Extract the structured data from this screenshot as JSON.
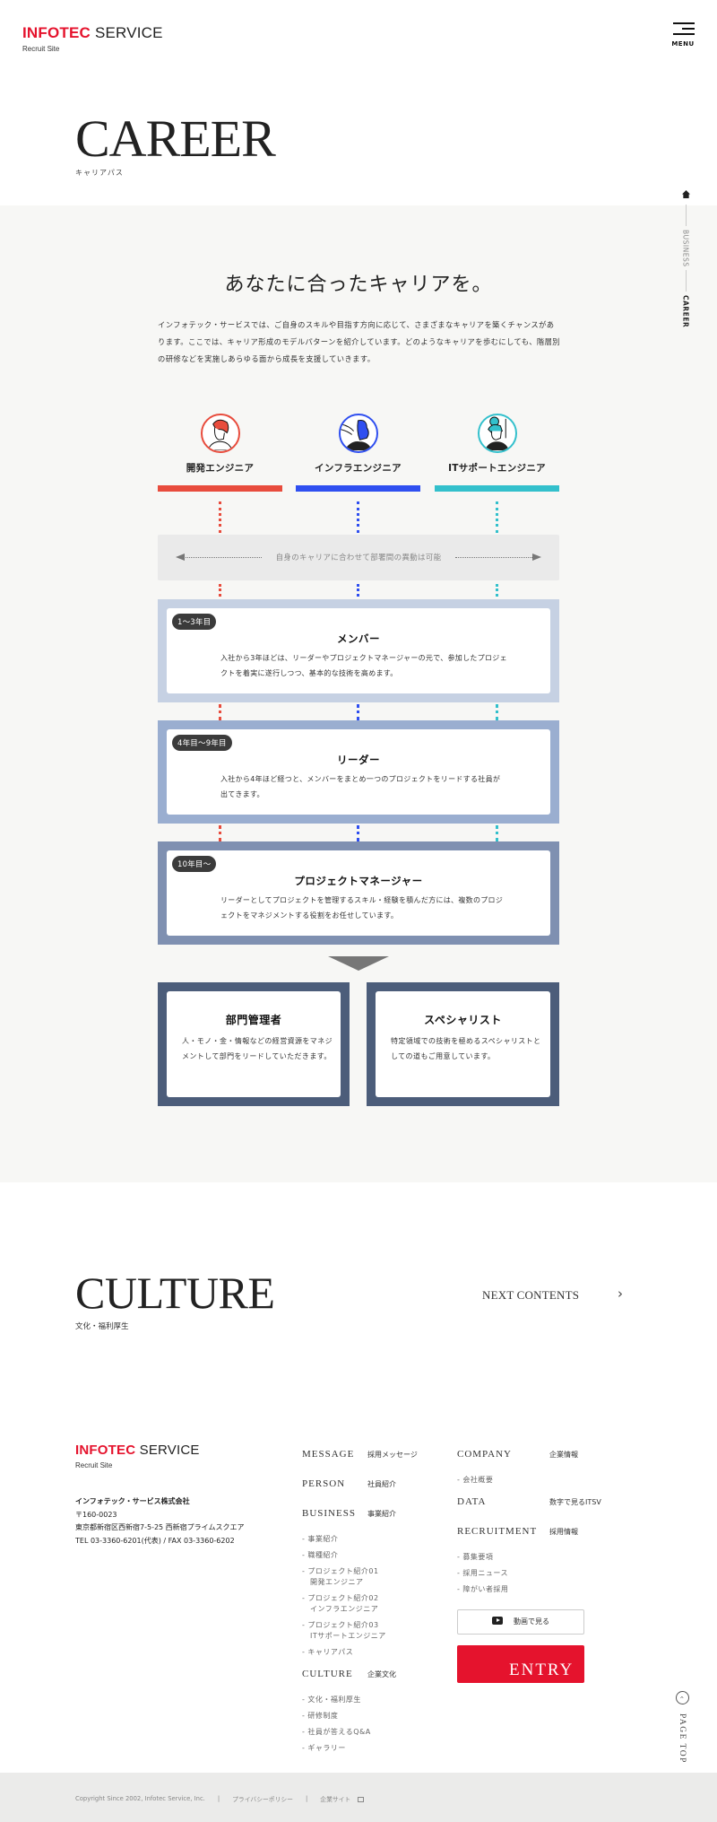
{
  "header": {
    "logo_brand": "INFOTEC",
    "logo_service": "SERVICE",
    "logo_sub": "Recruit Site",
    "menu_label": "MENU"
  },
  "page": {
    "title": "CAREER",
    "subtitle": "キャリアパス"
  },
  "side_nav": {
    "home_icon": "home-icon",
    "items": [
      {
        "label": "BUSINESS",
        "active": false
      },
      {
        "label": "CAREER",
        "active": true
      }
    ]
  },
  "career": {
    "catch": "あなたに合ったキャリアを。",
    "lead": "インフォテック・サービスでは、ご自身のスキルや目指す方向に応じて、さまざまなキャリアを築くチャンスがあります。ここでは、キャリア形成のモデルパターンを紹介しています。どのようなキャリアを歩むにしても、階層別の研修などを実施しあらゆる面から成長を支援していきます。",
    "jobs": [
      {
        "label": "開発エンジニア",
        "color": "#e84c3d",
        "icon": "developer-avatar-icon"
      },
      {
        "label": "インフラエンジニア",
        "color": "#2f4ff0",
        "icon": "infra-avatar-icon"
      },
      {
        "label": "ITサポートエンジニア",
        "color": "#33c0cc",
        "icon": "it-support-avatar-icon"
      }
    ],
    "transfer_text": "自身のキャリアに合わせて部署間の異動は可能",
    "stages": [
      {
        "badge": "1〜3年目",
        "title": "メンバー",
        "desc": "入社から3年ほどは、リーダーやプロジェクトマネージャーの元で、参加したプロジェクトを着実に遂行しつつ、基本的な技術を高めます。",
        "color": "#c6d1e3"
      },
      {
        "badge": "4年目〜9年目",
        "title": "リーダー",
        "desc": "入社から4年ほど経つと、メンバーをまとめ一つのプロジェクトをリードする社員が出てきます。",
        "color": "#9aaed0"
      },
      {
        "badge": "10年目〜",
        "title": "プロジェクトマネージャー",
        "desc": "リーダーとしてプロジェクトを管理するスキル・経験を積んだ方には、複数のプロジェクトをマネジメントする役割をお任せしています。",
        "color": "#7f90b1"
      }
    ],
    "finals": [
      {
        "title": "部門管理者",
        "desc": "人・モノ・金・情報などの経営資源をマネジメントして部門をリードしていただきます。"
      },
      {
        "title": "スペシャリスト",
        "desc": "特定領域での技術を極めるスペシャリストとしての道もご用意しています。"
      }
    ]
  },
  "next": {
    "title": "CULTURE",
    "subtitle": "文化・福利厚生",
    "link_label": "NEXT CONTENTS",
    "chevron": "›"
  },
  "footer": {
    "logo_brand": "INFOTEC",
    "logo_service": "SERVICE",
    "logo_sub": "Recruit Site",
    "company_name": "インフォテック・サービス株式会社",
    "postal": "〒160-0023",
    "address": "東京都新宿区西新宿7-5-25 西新宿プライムスクエア",
    "tel": "TEL 03-3360-6201(代表) / FAX 03-3360-6202",
    "col1": [
      {
        "en": "MESSAGE",
        "ja": "採用メッセージ",
        "subs": []
      },
      {
        "en": "PERSON",
        "ja": "社員紹介",
        "subs": []
      },
      {
        "en": "BUSINESS",
        "ja": "事業紹介",
        "subs": [
          {
            "l1": "- 事業紹介",
            "l2": ""
          },
          {
            "l1": "- 職種紹介",
            "l2": ""
          },
          {
            "l1": "- プロジェクト紹介01",
            "l2": "開発エンジニア"
          },
          {
            "l1": "- プロジェクト紹介02",
            "l2": "インフラエンジニア"
          },
          {
            "l1": "- プロジェクト紹介03",
            "l2": "ITサポートエンジニア"
          },
          {
            "l1": "- キャリアパス",
            "l2": ""
          }
        ]
      },
      {
        "en": "CULTURE",
        "ja": "企業文化",
        "subs": [
          {
            "l1": "- 文化・福利厚生",
            "l2": ""
          },
          {
            "l1": "- 研修制度",
            "l2": ""
          },
          {
            "l1": "- 社員が答えるQ&A",
            "l2": ""
          },
          {
            "l1": "- ギャラリー",
            "l2": ""
          }
        ]
      }
    ],
    "col2": [
      {
        "en": "COMPANY",
        "ja": "企業情報",
        "subs": [
          {
            "l1": "- 会社概要",
            "l2": ""
          }
        ]
      },
      {
        "en": "DATA",
        "ja": "数字で見るITSV",
        "subs": []
      },
      {
        "en": "RECRUITMENT",
        "ja": "採用情報",
        "subs": [
          {
            "l1": "- 募集要項",
            "l2": ""
          },
          {
            "l1": "- 採用ニュース",
            "l2": ""
          },
          {
            "l1": "- 障がい者採用",
            "l2": ""
          }
        ]
      }
    ],
    "video_label": "動画で見る",
    "entry_label": "ENTRY",
    "page_top_label": "PAGE TOP",
    "copyright": "Copyright Since 2002, Infotec Service, Inc.",
    "privacy_label": "プライバシーポリシー",
    "corporate_label": "企業サイト",
    "separator": "|"
  }
}
